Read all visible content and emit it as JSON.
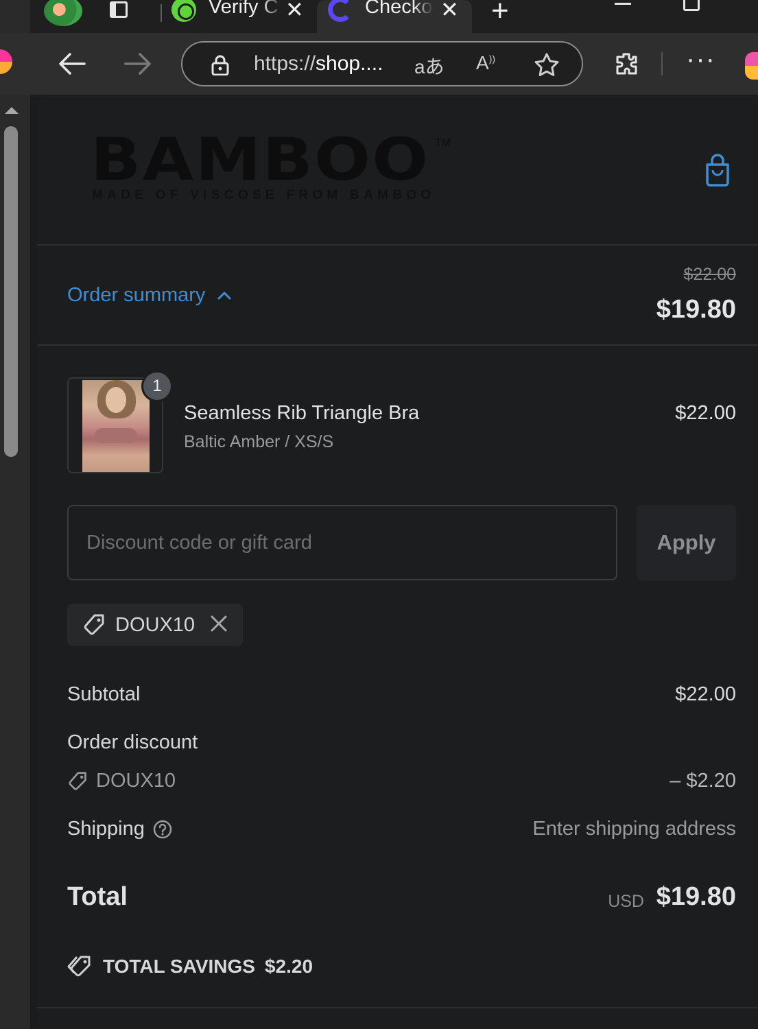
{
  "browser": {
    "tabs": [
      {
        "title": "Verify C",
        "favicon": "green-check-favicon",
        "active": false
      },
      {
        "title": "Checkout",
        "favicon": "purple-ring-favicon",
        "active": true
      }
    ],
    "url": {
      "scheme": "https://",
      "host": "shop...."
    },
    "icons": [
      "back-icon",
      "forward-icon",
      "lock-icon",
      "translate-icon",
      "read-aloud-icon",
      "favorite-star-icon",
      "extensions-icon",
      "more-icon"
    ]
  },
  "store": {
    "logo": "BAMBOO",
    "logo_tm": "TM",
    "tagline": "MADE OF VISCOSE FROM BAMBOO",
    "accent_color": "#3c8ed6"
  },
  "summary": {
    "toggle_label": "Order summary",
    "compare_price": "$22.00",
    "total": "$19.80"
  },
  "line_items": [
    {
      "quantity": "1",
      "title": "Seamless Rib Triangle Bra",
      "variant": "Baltic Amber / XS/S",
      "price": "$22.00"
    }
  ],
  "discount": {
    "placeholder": "Discount code or gift card",
    "value": "",
    "apply_label": "Apply",
    "applied_code": "DOUX10"
  },
  "totals": {
    "subtotal_label": "Subtotal",
    "subtotal_value": "$22.00",
    "discount_label": "Order discount",
    "discount_code": "DOUX10",
    "discount_value": "– $2.20",
    "shipping_label": "Shipping",
    "shipping_value": "Enter shipping address",
    "total_label": "Total",
    "total_currency": "USD",
    "total_value": "$19.80",
    "savings_label": "TOTAL SAVINGS",
    "savings_value": "$2.20"
  }
}
